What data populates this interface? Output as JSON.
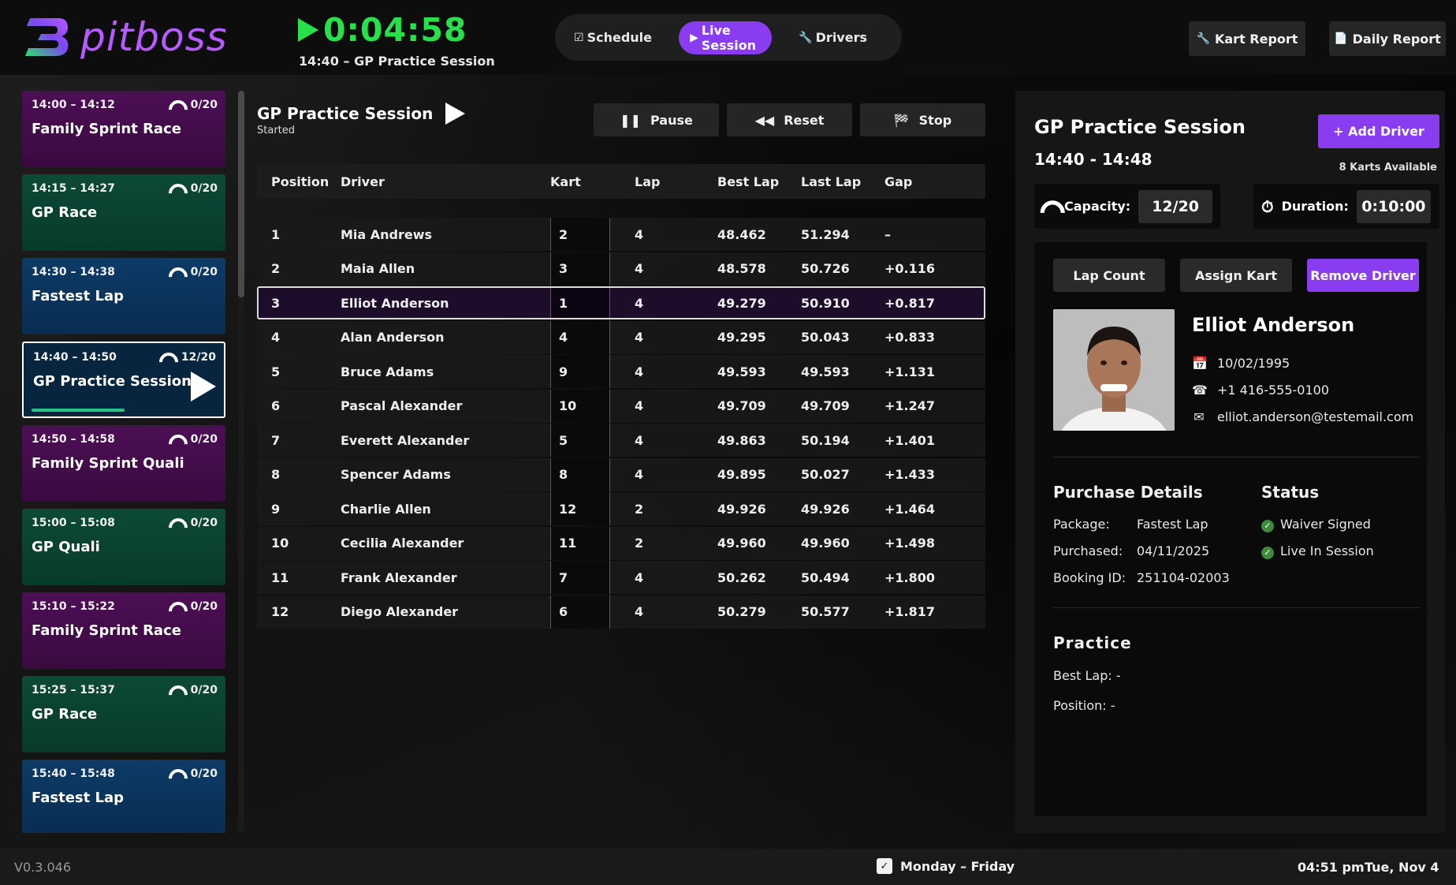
{
  "header": {
    "logo_text": "pitboss",
    "timer": "0:04:58",
    "timer_sub": "14:40 – GP Practice Session",
    "nav": [
      {
        "label": "Schedule",
        "icon": "checkbox-icon",
        "active": false
      },
      {
        "label": "Live Session",
        "icon": "play-icon",
        "active": true
      },
      {
        "label": "Drivers",
        "icon": "wrench-icon",
        "active": false
      }
    ],
    "kart_report": "Kart Report",
    "daily_report": "Daily Report"
  },
  "sessions": [
    {
      "time": "14:00 – 14:12",
      "capacity": "0/20",
      "name": "Family Sprint Race",
      "color": "purple",
      "active": false
    },
    {
      "time": "14:15 – 14:27",
      "capacity": "0/20",
      "name": "GP Race",
      "color": "green",
      "active": false
    },
    {
      "time": "14:30 – 14:38",
      "capacity": "0/20",
      "name": "Fastest Lap",
      "color": "blue",
      "active": false
    },
    {
      "time": "14:40 – 14:50",
      "capacity": "12/20",
      "name": "GP Practice Session",
      "color": "blue",
      "active": true
    },
    {
      "time": "14:50 – 14:58",
      "capacity": "0/20",
      "name": "Family Sprint Quali",
      "color": "purple",
      "active": false
    },
    {
      "time": "15:00 – 15:08",
      "capacity": "0/20",
      "name": "GP Quali",
      "color": "green",
      "active": false
    },
    {
      "time": "15:10 – 15:22",
      "capacity": "0/20",
      "name": "Family Sprint Race",
      "color": "purple",
      "active": false
    },
    {
      "time": "15:25 – 15:37",
      "capacity": "0/20",
      "name": "GP Race",
      "color": "green",
      "active": false
    },
    {
      "time": "15:40 – 15:48",
      "capacity": "0/20",
      "name": "Fastest Lap",
      "color": "blue",
      "active": false
    }
  ],
  "live": {
    "title": "GP Practice Session",
    "status": "Started",
    "controls": {
      "pause": "Pause",
      "reset": "Reset",
      "stop": "Stop"
    },
    "columns": [
      "Position",
      "Driver",
      "Kart",
      "Lap",
      "Best Lap",
      "Last Lap",
      "Gap"
    ],
    "rows": [
      {
        "pos": "1",
        "driver": "Mia Andrews",
        "kart": "2",
        "lap": "4",
        "best": "48.462",
        "last": "51.294",
        "gap": "–"
      },
      {
        "pos": "2",
        "driver": "Maia Allen",
        "kart": "3",
        "lap": "4",
        "best": "48.578",
        "last": "50.726",
        "gap": "+0.116"
      },
      {
        "pos": "3",
        "driver": "Elliot Anderson",
        "kart": "1",
        "lap": "4",
        "best": "49.279",
        "last": "50.910",
        "gap": "+0.817"
      },
      {
        "pos": "4",
        "driver": "Alan Anderson",
        "kart": "4",
        "lap": "4",
        "best": "49.295",
        "last": "50.043",
        "gap": "+0.833"
      },
      {
        "pos": "5",
        "driver": "Bruce Adams",
        "kart": "9",
        "lap": "4",
        "best": "49.593",
        "last": "49.593",
        "gap": "+1.131"
      },
      {
        "pos": "6",
        "driver": "Pascal Alexander",
        "kart": "10",
        "lap": "4",
        "best": "49.709",
        "last": "49.709",
        "gap": "+1.247"
      },
      {
        "pos": "7",
        "driver": "Everett Alexander",
        "kart": "5",
        "lap": "4",
        "best": "49.863",
        "last": "50.194",
        "gap": "+1.401"
      },
      {
        "pos": "8",
        "driver": "Spencer Adams",
        "kart": "8",
        "lap": "4",
        "best": "49.895",
        "last": "50.027",
        "gap": "+1.433"
      },
      {
        "pos": "9",
        "driver": "Charlie Allen",
        "kart": "12",
        "lap": "2",
        "best": "49.926",
        "last": "49.926",
        "gap": "+1.464"
      },
      {
        "pos": "10",
        "driver": "Cecilia Alexander",
        "kart": "11",
        "lap": "2",
        "best": "49.960",
        "last": "49.960",
        "gap": "+1.498"
      },
      {
        "pos": "11",
        "driver": "Frank Alexander",
        "kart": "7",
        "lap": "4",
        "best": "50.262",
        "last": "50.494",
        "gap": "+1.800"
      },
      {
        "pos": "12",
        "driver": "Diego Alexander",
        "kart": "6",
        "lap": "4",
        "best": "50.279",
        "last": "50.577",
        "gap": "+1.817"
      }
    ],
    "selected_row": 2
  },
  "panel": {
    "title": "GP Practice Session",
    "time": "14:40 - 14:48",
    "add_driver": "+ Add Driver",
    "karts_available": "8 Karts Available",
    "capacity_label": "Capacity:",
    "capacity_value": "12/20",
    "duration_label": "Duration:",
    "duration_value": "0:10:00",
    "actions": {
      "lap_count": "Lap Count",
      "assign_kart": "Assign Kart",
      "remove_driver": "Remove Driver"
    },
    "driver": {
      "name": "Elliot Anderson",
      "dob": "10/02/1995",
      "phone": "+1 416-555-0100",
      "email": "elliot.anderson@testemail.com"
    },
    "purchase": {
      "title": "Purchase Details",
      "package_label": "Package:",
      "package": "Fastest Lap",
      "purchased_label": "Purchased:",
      "purchased": "04/11/2025",
      "booking_label": "Booking ID:",
      "booking": "251104-02003"
    },
    "status": {
      "title": "Status",
      "items": [
        "Waiver Signed",
        "Live In Session"
      ]
    },
    "practice": {
      "title": "Practice",
      "best_lap": "Best Lap: -",
      "position": "Position: -"
    }
  },
  "footer": {
    "version": "V0.3.046",
    "days": "Monday – Friday",
    "time": "04:51 pm",
    "date": "Tue, Nov 4"
  },
  "colors": {
    "accent": "#8a3df0",
    "timer_green": "#27e04a",
    "card_purple": "#4d0e55",
    "card_green": "#0c4a36",
    "card_blue": "#0c3b67"
  }
}
